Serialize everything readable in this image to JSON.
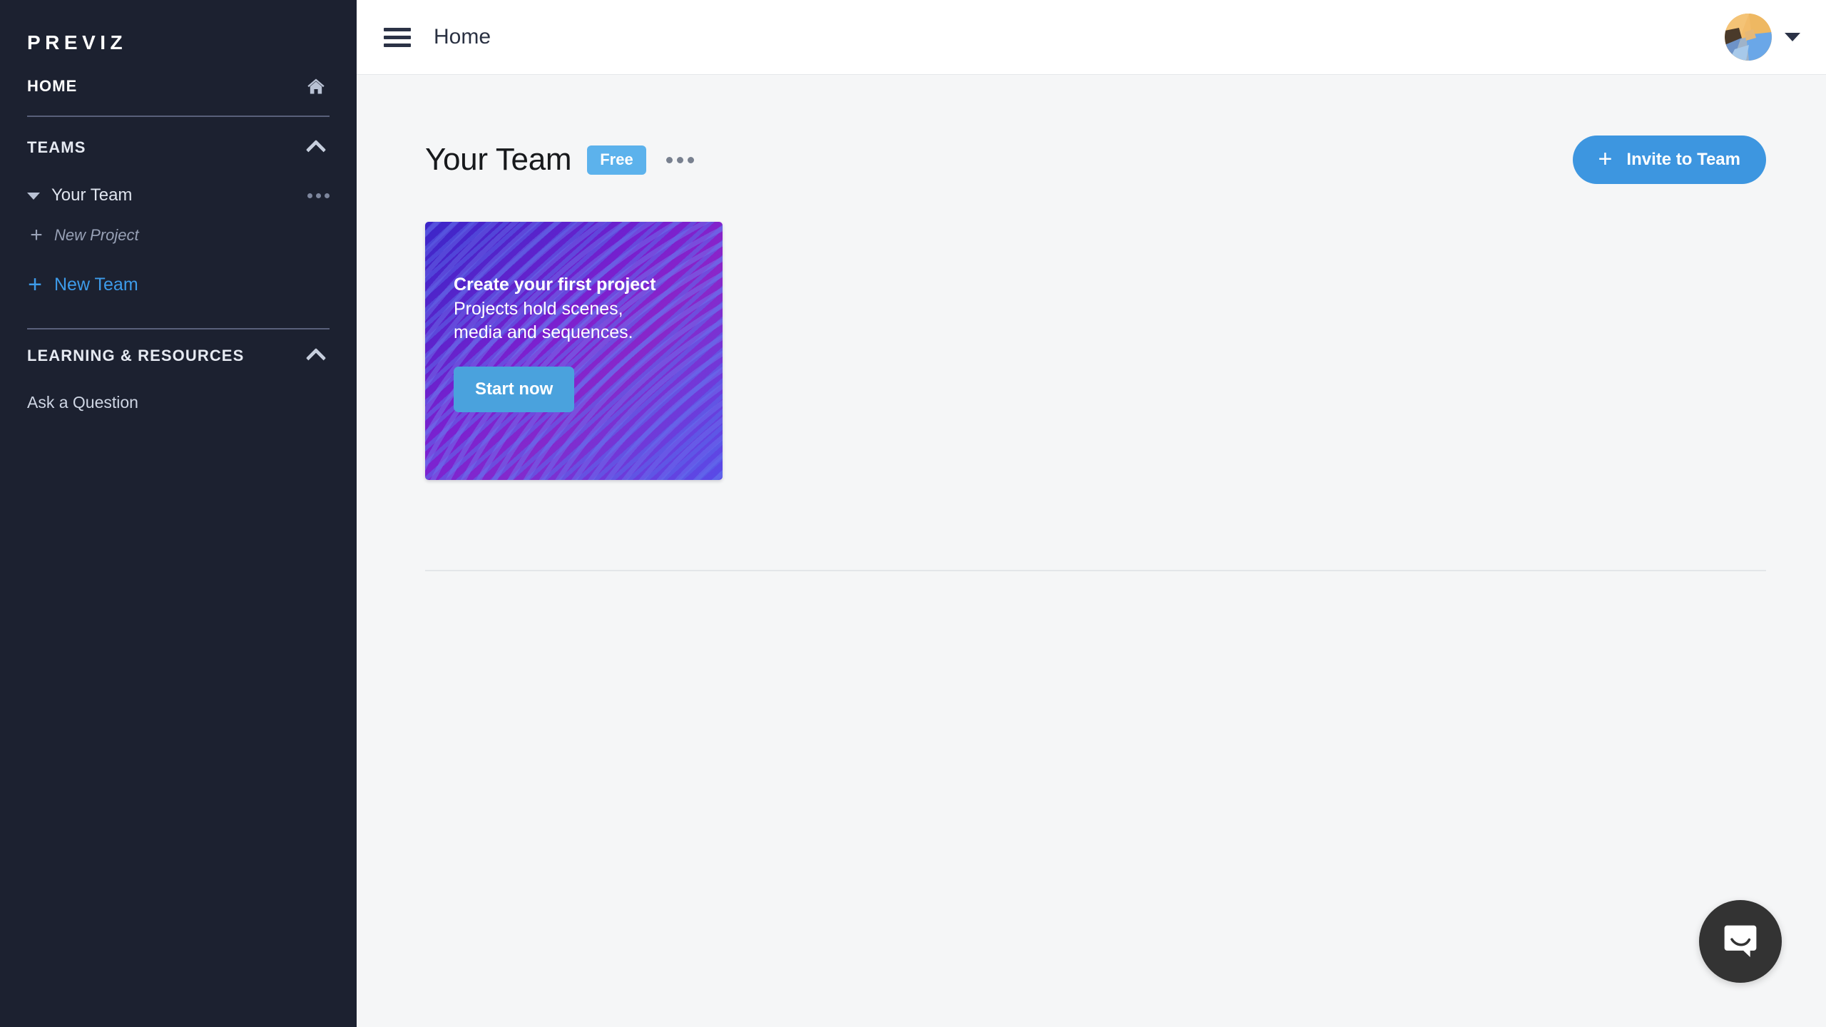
{
  "brand": "PREVIZ",
  "sidebar": {
    "home": {
      "label": "HOME",
      "icon": "home-icon"
    },
    "teams_section": {
      "label": "TEAMS",
      "collapse_icon": "chevron-up-icon"
    },
    "team": {
      "name": "Your Team",
      "menu_icon": "ellipsis-icon"
    },
    "new_project": {
      "label": "New Project",
      "icon": "plus-icon"
    },
    "new_team": {
      "label": "New Team",
      "icon": "plus-icon"
    },
    "learning_section": {
      "label": "LEARNING & RESOURCES",
      "collapse_icon": "chevron-up-icon"
    },
    "learning_items": [
      {
        "label": "Ask a Question"
      }
    ]
  },
  "topbar": {
    "menu_icon": "hamburger-icon",
    "breadcrumb": "Home",
    "avatar": "user-avatar",
    "caret": "chevron-down-icon"
  },
  "main": {
    "title": "Your Team",
    "plan_badge": "Free",
    "overflow_icon": "ellipsis-icon",
    "invite_button": {
      "label": "Invite to Team",
      "icon": "plus-icon",
      "color": "#3d96e0"
    }
  },
  "promo_card": {
    "title": "Create your first project",
    "body_line1": "Projects hold scenes,",
    "body_line2": "media and sequences.",
    "cta": "Start now",
    "cta_color": "#4aa2dd",
    "gradient_from": "#3b28c8",
    "gradient_to": "#5b4de8"
  },
  "support": {
    "launcher_icon": "chat-bubble-icon",
    "launcher_color": "#333333"
  },
  "theme": {
    "sidebar_bg": "#1c2130",
    "page_bg": "#f5f6f7",
    "topbar_bg": "#ffffff",
    "accent": "#3d96e0",
    "badge_bg": "#5cb2ec"
  }
}
